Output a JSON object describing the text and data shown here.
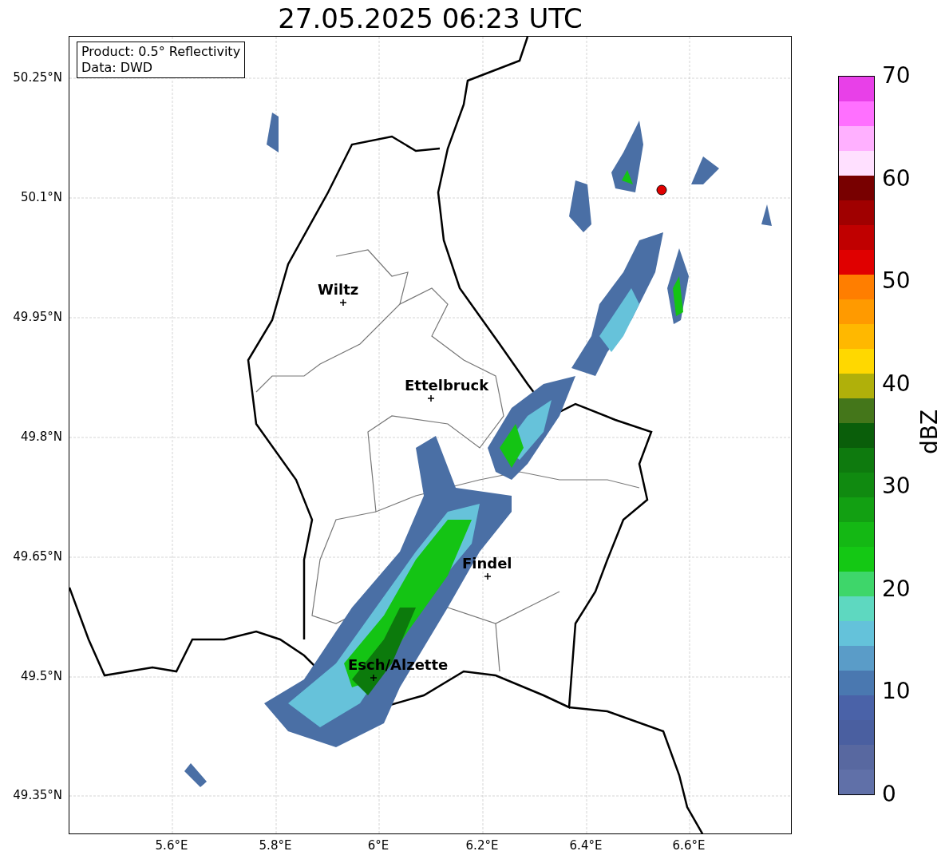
{
  "title": "27.05.2025 06:23 UTC",
  "legend": [
    "Product: 0.5° Reflectivity",
    "Data: DWD"
  ],
  "map": {
    "cities": [
      {
        "name": "Wiltz"
      },
      {
        "name": "Ettelbruck"
      },
      {
        "name": "Findel"
      },
      {
        "name": "Esch/Alzette"
      }
    ]
  },
  "y_axis": {
    "ticks": [
      "50.25°N",
      "50.1°N",
      "49.95°N",
      "49.8°N",
      "49.65°N",
      "49.5°N",
      "49.35°N"
    ]
  },
  "x_axis": {
    "ticks": [
      "5.6°E",
      "5.8°E",
      "6°E",
      "6.2°E",
      "6.4°E",
      "6.6°E"
    ]
  },
  "colorbar": {
    "label": "dBZ",
    "ticks": [
      "70",
      "60",
      "50",
      "40",
      "30",
      "20",
      "10",
      "0"
    ]
  }
}
